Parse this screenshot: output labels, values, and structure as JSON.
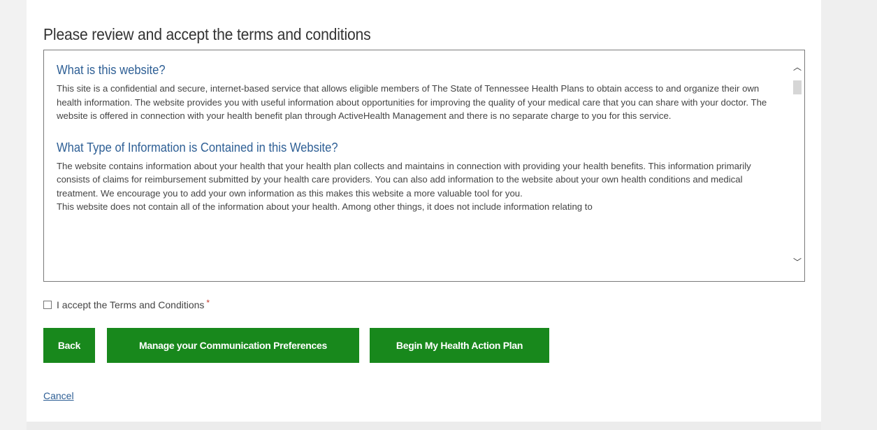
{
  "page": {
    "title": "Please review and accept the terms and conditions"
  },
  "terms": {
    "sections": [
      {
        "heading": "What is this website?",
        "body": "This site is a confidential and secure, internet-based service that allows eligible members of The State of Tennessee Health Plans to obtain access to and organize their own health information. The website provides you with useful information about opportunities for improving the quality of your medical care that you can share with your doctor. The website is offered in connection with your health benefit plan through ActiveHealth Management and there is no separate charge to you for this service."
      },
      {
        "heading": "What Type of Information is Contained in this Website?",
        "body": "The website contains information about your health that your health plan collects and maintains in connection with providing your health benefits. This information primarily consists of claims for reimbursement submitted by your health care providers. You can also add information to the website about your own health conditions and medical treatment. We encourage you to add your own information as this makes this website a more valuable tool for you.",
        "body_continued": "This website does not contain all of the information about your health. Among other things, it does not include information relating to"
      }
    ]
  },
  "accept": {
    "label": "I accept the Terms and Conditions",
    "required_marker": "*",
    "checked": false
  },
  "buttons": {
    "back": "Back",
    "preferences": "Manage your Communication Preferences",
    "begin": "Begin My Health Action Plan"
  },
  "links": {
    "cancel": "Cancel"
  },
  "colors": {
    "button": "#18881c",
    "heading": "#2e5f95",
    "link": "#2e5f95"
  }
}
